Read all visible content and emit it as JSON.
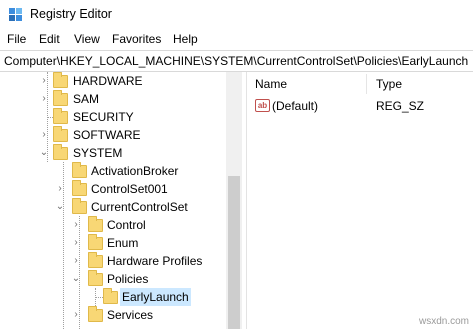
{
  "window": {
    "title": "Registry Editor"
  },
  "menu": [
    "File",
    "Edit",
    "View",
    "Favorites",
    "Help"
  ],
  "address": "Computer\\HKEY_LOCAL_MACHINE\\SYSTEM\\CurrentControlSet\\Policies\\EarlyLaunch",
  "tree": [
    {
      "label": "HARDWARE",
      "expander": "collapsed"
    },
    {
      "label": "SAM",
      "expander": "collapsed"
    },
    {
      "label": "SECURITY",
      "expander": "none"
    },
    {
      "label": "SOFTWARE",
      "expander": "collapsed"
    },
    {
      "label": "SYSTEM",
      "expander": "expanded"
    },
    {
      "label": "ActivationBroker",
      "expander": "collapsed"
    },
    {
      "label": "ControlSet001",
      "expander": "collapsed"
    },
    {
      "label": "CurrentControlSet",
      "expander": "expanded"
    },
    {
      "label": "Control",
      "expander": "collapsed"
    },
    {
      "label": "Enum",
      "expander": "collapsed"
    },
    {
      "label": "Hardware Profiles",
      "expander": "collapsed"
    },
    {
      "label": "Policies",
      "expander": "expanded"
    },
    {
      "label": "EarlyLaunch",
      "expander": "none",
      "selected": true
    },
    {
      "label": "Services",
      "expander": "collapsed"
    }
  ],
  "list": {
    "columns": {
      "name": "Name",
      "type": "Type"
    },
    "rows": [
      {
        "icon": "string-value-icon",
        "icon_text": "ab",
        "name": "(Default)",
        "type": "REG_SZ"
      }
    ]
  },
  "watermark": "wsxdn.com",
  "colors": {
    "selection": "#cce8ff",
    "folder": "#f8d775",
    "string_icon": "#c0504d"
  }
}
